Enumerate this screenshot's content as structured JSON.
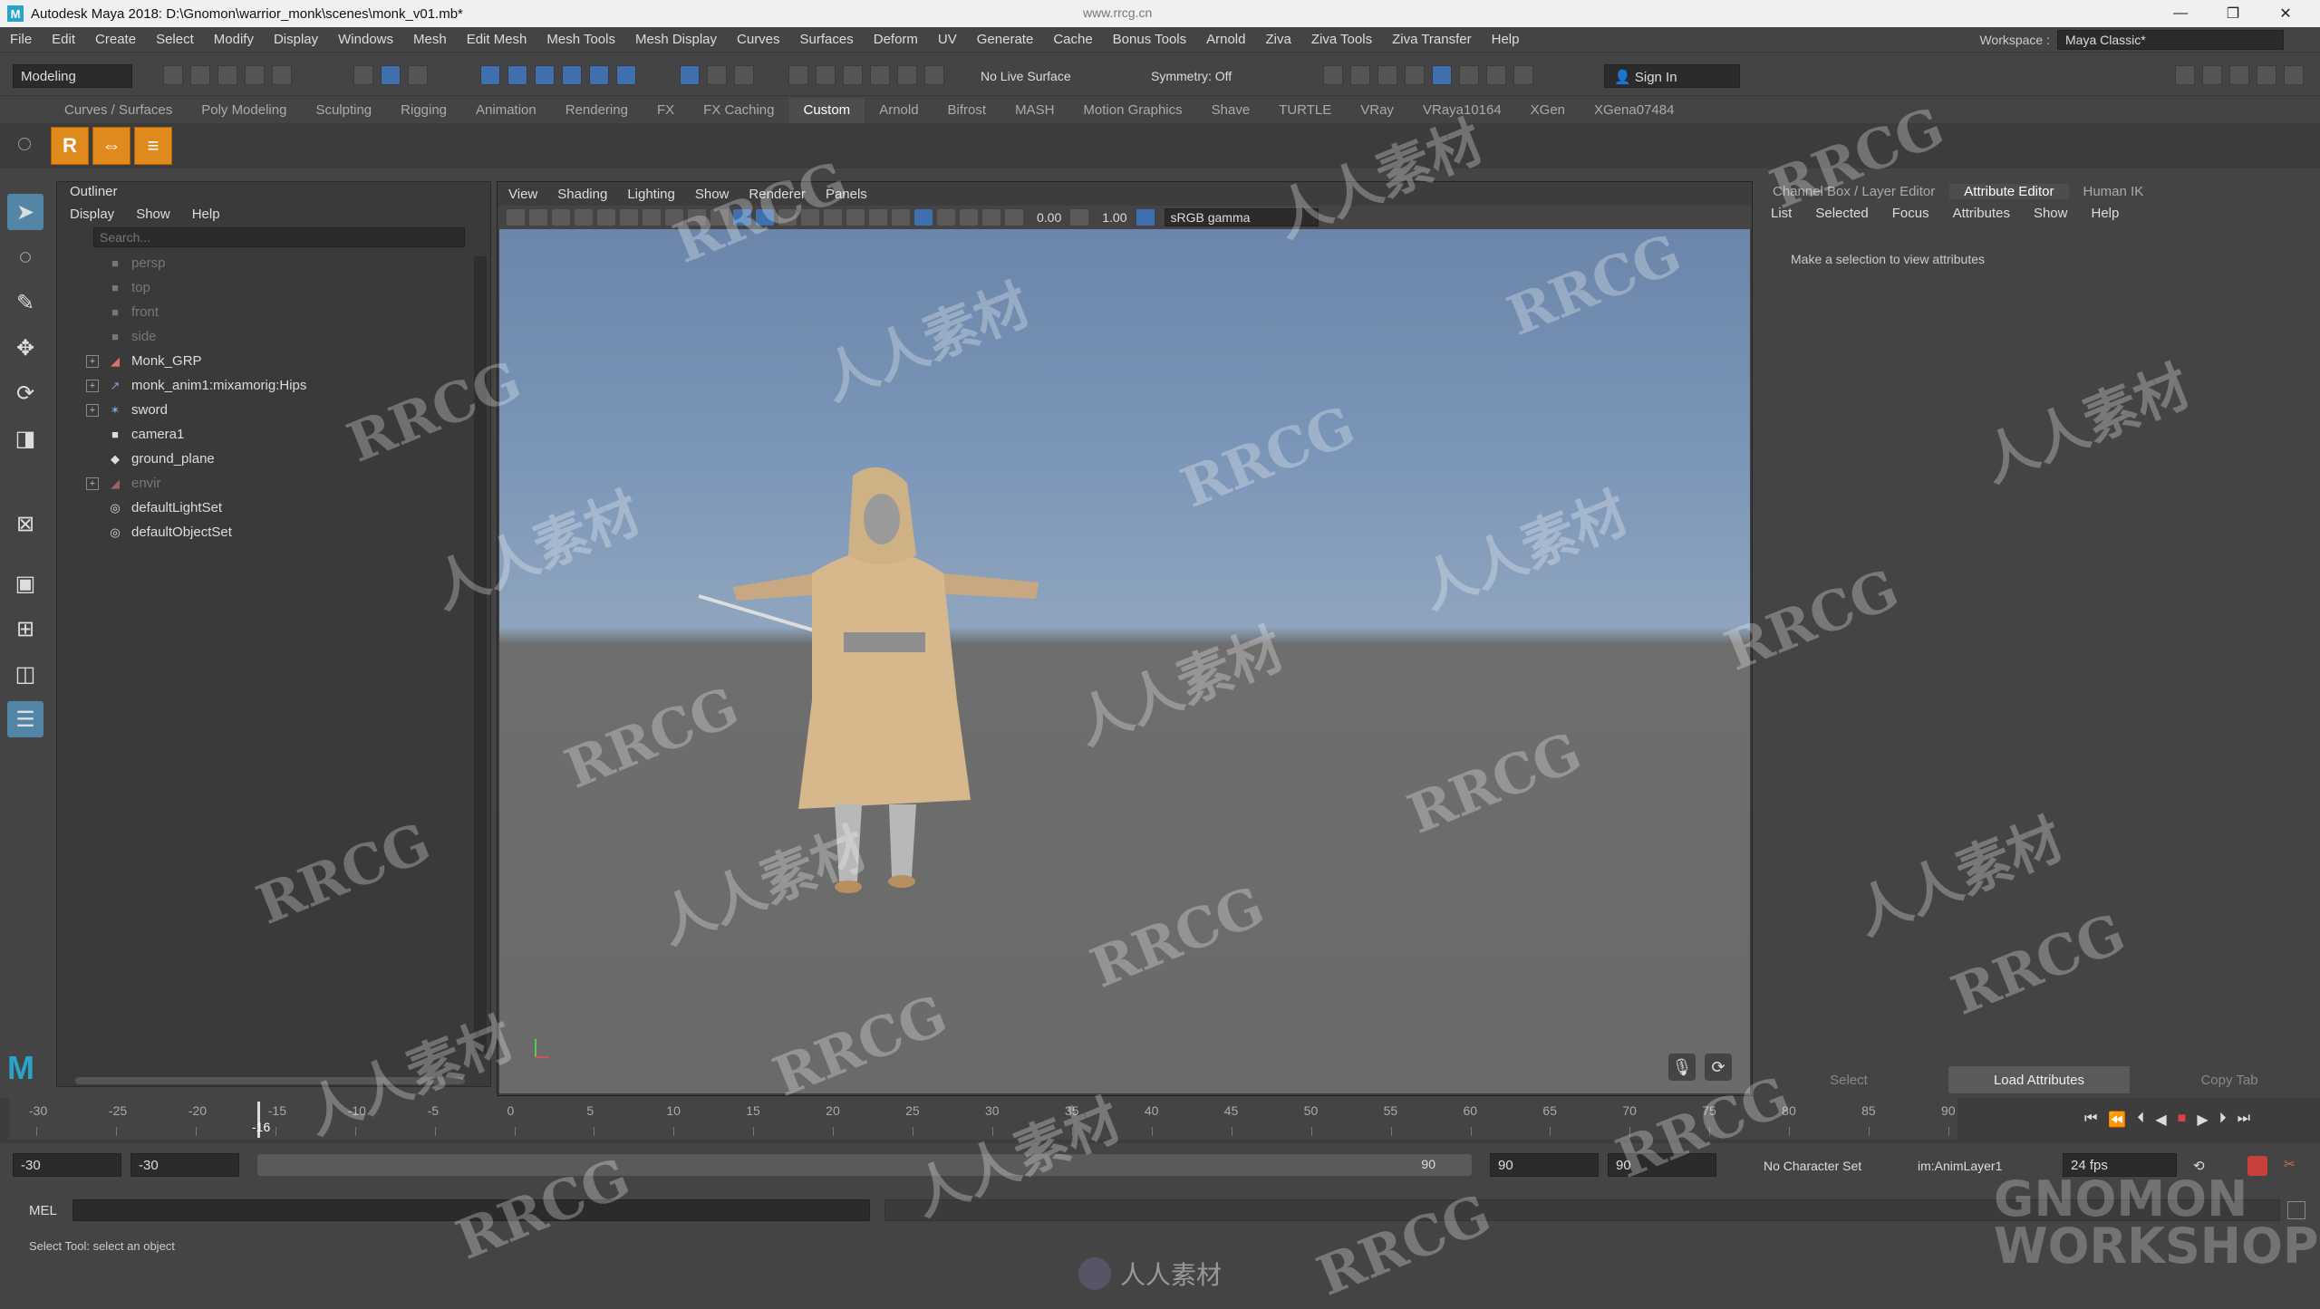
{
  "titlebar": {
    "title": "Autodesk Maya 2018: D:\\Gnomon\\warrior_monk\\scenes\\monk_v01.mb*",
    "watermark_url": "www.rrcg.cn"
  },
  "menubar": {
    "items": [
      "File",
      "Edit",
      "Create",
      "Select",
      "Modify",
      "Display",
      "Windows",
      "Mesh",
      "Edit Mesh",
      "Mesh Tools",
      "Mesh Display",
      "Curves",
      "Surfaces",
      "Deform",
      "UV",
      "Generate",
      "Cache",
      "Bonus Tools",
      "Arnold",
      "Ziva",
      "Ziva Tools",
      "Ziva Transfer",
      "Help"
    ],
    "workspace_label": "Workspace :",
    "workspace_value": "Maya Classic*"
  },
  "statusline": {
    "mode": "Modeling",
    "live_surface": "No Live Surface",
    "symmetry": "Symmetry: Off",
    "sign_in": "Sign In"
  },
  "shelf": {
    "tabs": [
      "Curves / Surfaces",
      "Poly Modeling",
      "Sculpting",
      "Rigging",
      "Animation",
      "Rendering",
      "FX",
      "FX Caching",
      "Custom",
      "Arnold",
      "Bifrost",
      "MASH",
      "Motion Graphics",
      "Shave",
      "TURTLE",
      "VRay",
      "VRaya10164",
      "XGen",
      "XGena07484"
    ],
    "active_tab": "Custom"
  },
  "outliner": {
    "title": "Outliner",
    "menu": [
      "Display",
      "Show",
      "Help"
    ],
    "search_placeholder": "Search...",
    "items": [
      {
        "label": "persp",
        "dim": true
      },
      {
        "label": "top",
        "dim": true
      },
      {
        "label": "front",
        "dim": true
      },
      {
        "label": "side",
        "dim": true
      },
      {
        "label": "Monk_GRP"
      },
      {
        "label": "monk_anim1:mixamorig:Hips"
      },
      {
        "label": "sword"
      },
      {
        "label": "camera1"
      },
      {
        "label": "ground_plane"
      },
      {
        "label": "envir",
        "dim": true
      },
      {
        "label": "defaultLightSet"
      },
      {
        "label": "defaultObjectSet"
      }
    ]
  },
  "viewport": {
    "menu": [
      "View",
      "Shading",
      "Lighting",
      "Show",
      "Renderer",
      "Panels"
    ],
    "exposure": "0.00",
    "gamma": "1.00",
    "color_space": "sRGB gamma"
  },
  "rightpanel": {
    "tabs": [
      "Channel Box / Layer Editor",
      "Attribute Editor",
      "Human IK"
    ],
    "active_tab": "Attribute Editor",
    "menu": [
      "List",
      "Selected",
      "Focus",
      "Attributes",
      "Show",
      "Help"
    ],
    "message": "Make a selection to view attributes",
    "buttons": [
      "Select",
      "Load Attributes",
      "Copy Tab"
    ]
  },
  "timeline": {
    "ticks": [
      "-30",
      "-25",
      "-20",
      "-15",
      "-10",
      "-5",
      "0",
      "5",
      "10",
      "15",
      "20",
      "25",
      "30",
      "35",
      "40",
      "45",
      "50",
      "55",
      "60",
      "65",
      "70",
      "75",
      "80",
      "85",
      "90"
    ],
    "current": "-16"
  },
  "range": {
    "start": "-30",
    "start_inner": "-30",
    "end_inner": "90",
    "end": "90",
    "end2": "90",
    "character_set": "No Character Set",
    "anim_layer": "im:AnimLayer1",
    "fps": "24 fps"
  },
  "mel": {
    "label": "MEL"
  },
  "helpline": {
    "text": "Select Tool: select an object"
  },
  "watermarks": {
    "rrcg": "RRCG",
    "cn": "人人素材",
    "bottom": "人人素材",
    "brand_a": "GNOMON",
    "brand_b": "WORKSHOP"
  }
}
